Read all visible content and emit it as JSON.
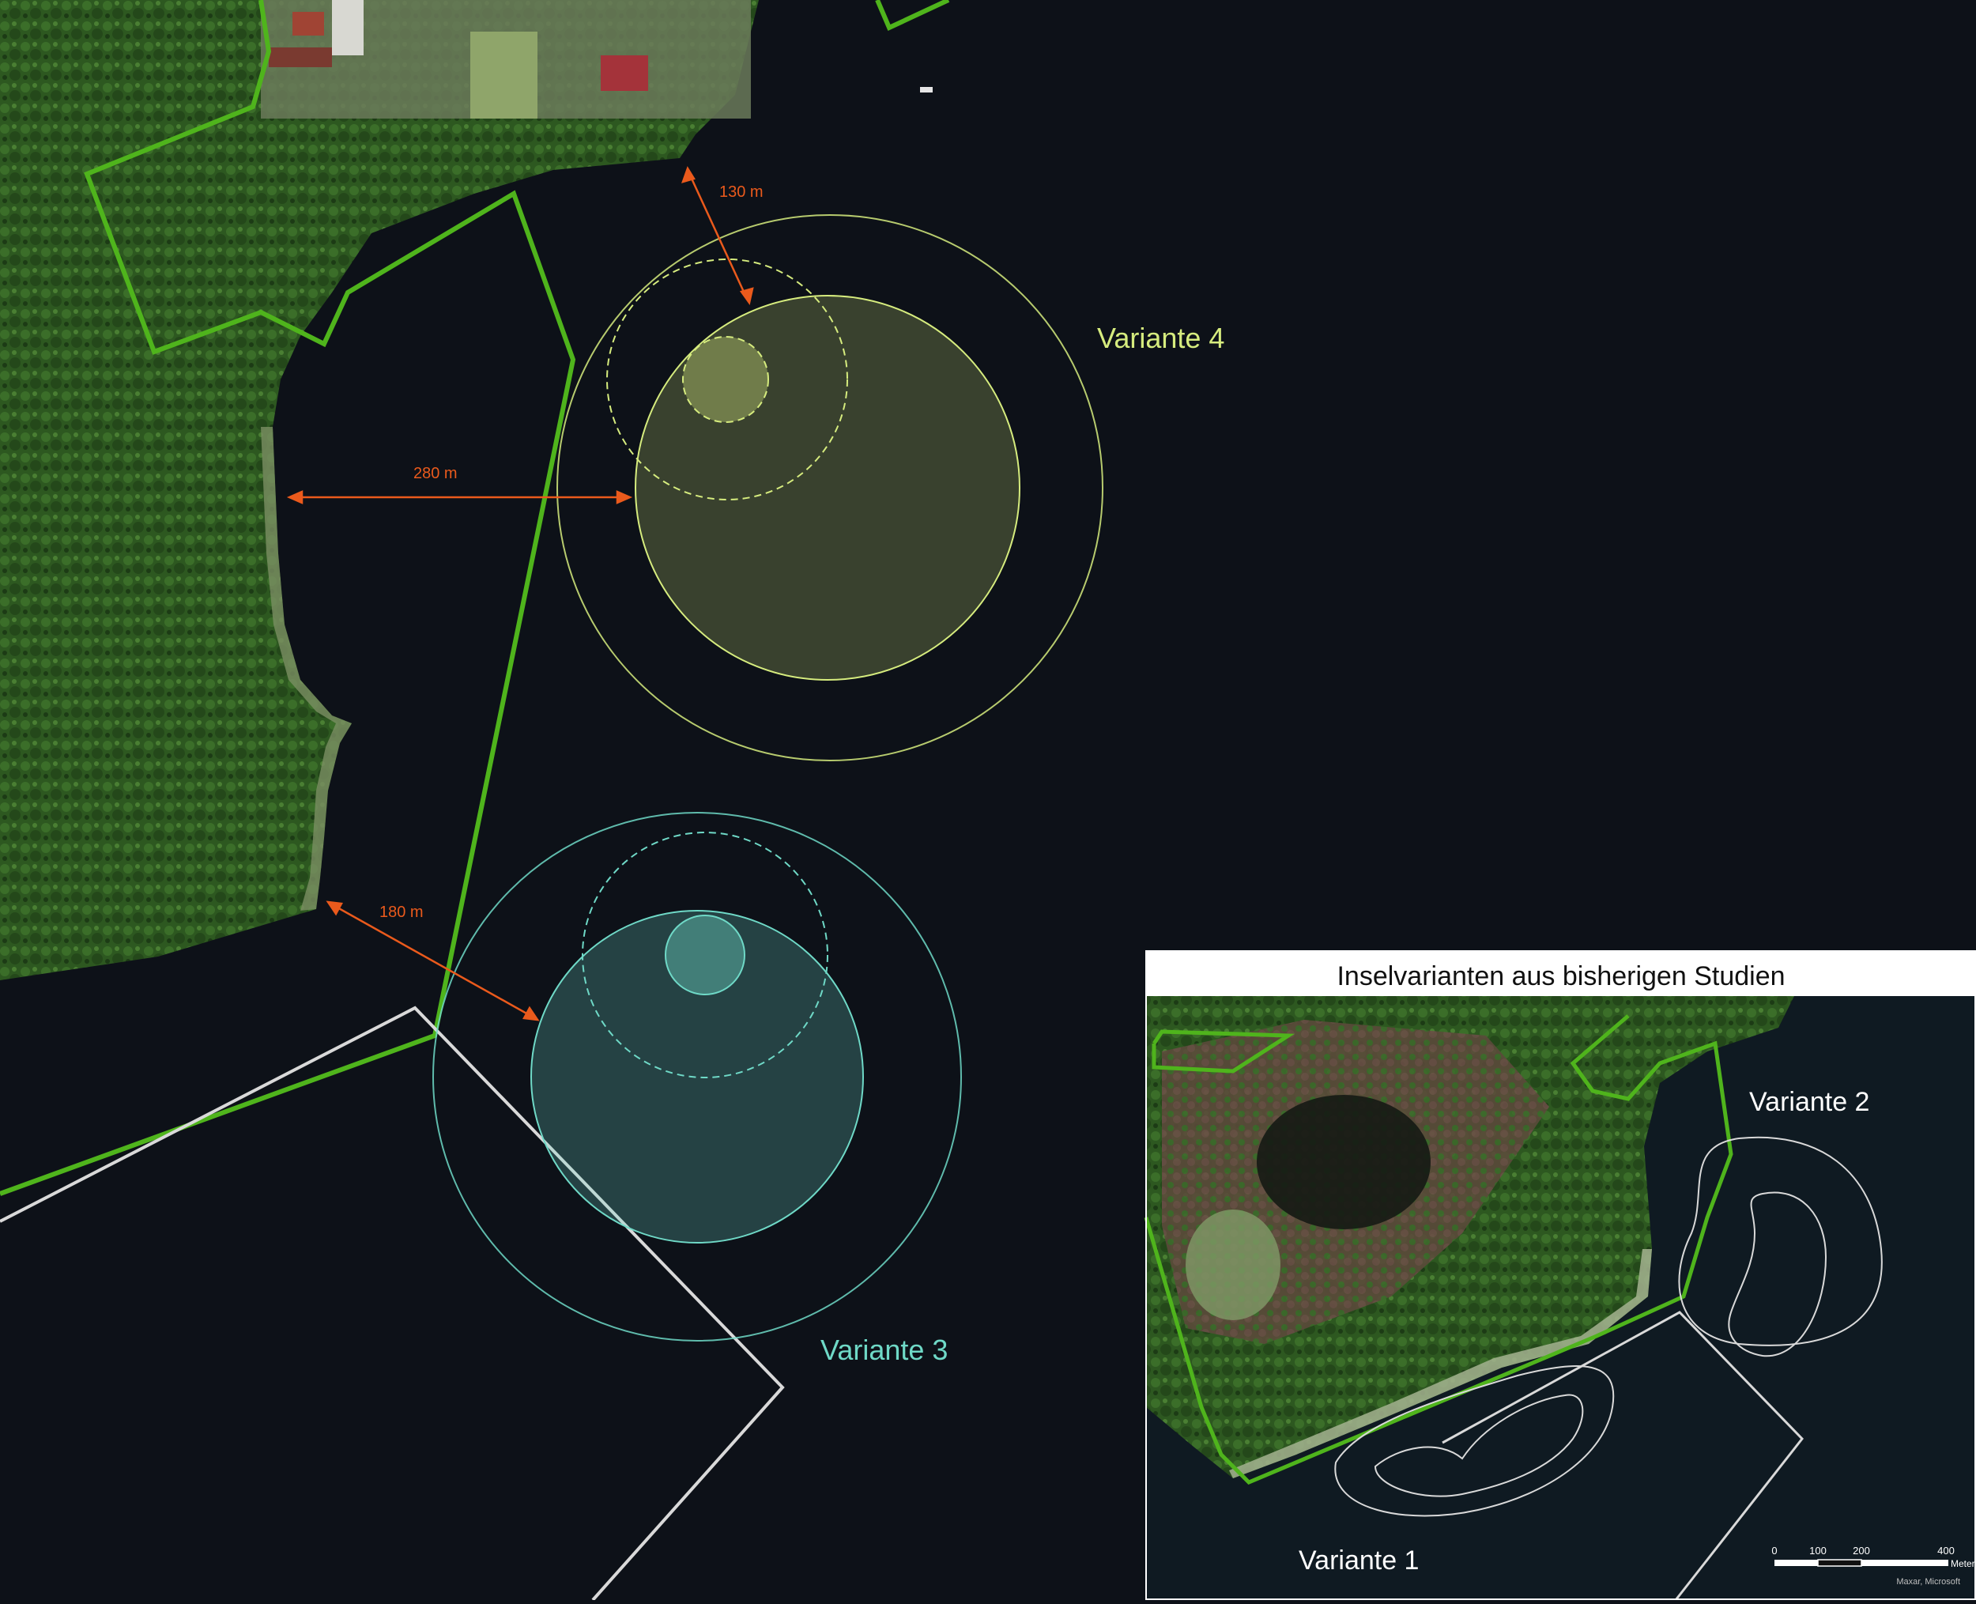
{
  "map": {
    "variants": {
      "v4": {
        "label": "Variante 4",
        "color": "#d6ec7e"
      },
      "v3": {
        "label": "Variante 3",
        "color": "#6fd9c7"
      }
    },
    "distances": {
      "d130": "130 m",
      "d280": "280 m",
      "d180": "180 m"
    },
    "colors": {
      "water": "#0d1118",
      "forest": "#2f5a22",
      "boundary": "#4fb41c",
      "measure": "#ea5a1c",
      "outline": "#d9d9d9"
    }
  },
  "inset": {
    "title": "Inselvarianten aus bisherigen Studien",
    "labels": {
      "v2": "Variante 2",
      "v1": "Variante 1"
    },
    "scale": {
      "ticks": [
        "0",
        "100",
        "200",
        "400"
      ],
      "unit": "Meter"
    },
    "attribution": "Maxar, Microsoft"
  }
}
